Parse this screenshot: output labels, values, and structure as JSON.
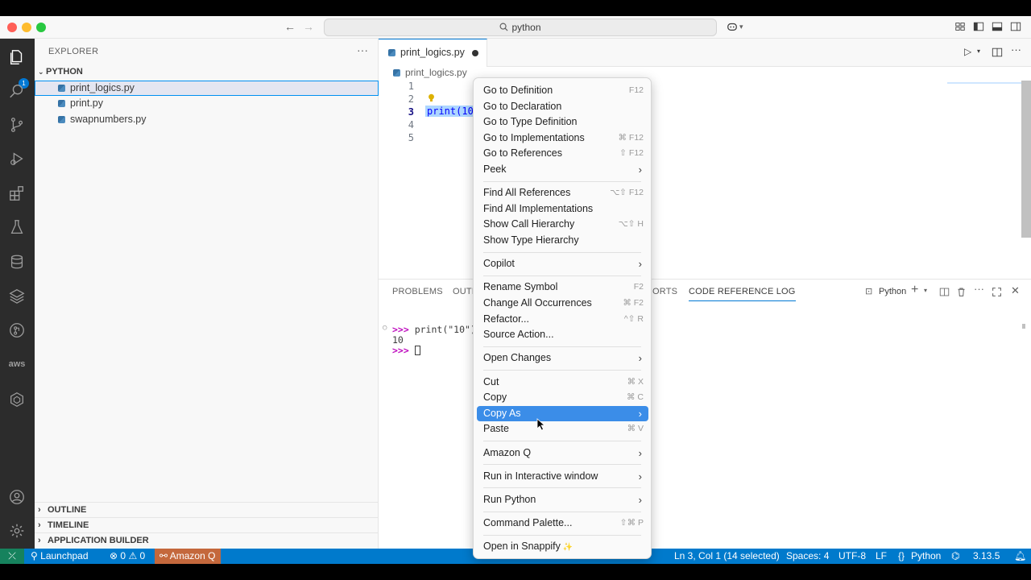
{
  "titlebar": {
    "search_text": "python",
    "search_icon": "search-icon",
    "copilot_icon": "copilot-icon"
  },
  "activity_bar": {
    "explorer_badge": "1",
    "items": [
      "files-icon",
      "search-icon",
      "source-control-icon",
      "run-debug-icon",
      "extensions-icon",
      "testing-icon",
      "database-icon",
      "layers-icon",
      "gitlens-icon",
      "aws-icon",
      "hexagon-icon"
    ],
    "aws_label": "aws",
    "bottom_items": [
      "account-icon",
      "settings-gear-icon"
    ]
  },
  "sidebar": {
    "header": "EXPLORER",
    "more": "···",
    "folder": "PYTHON",
    "files": [
      "print_logics.py",
      "print.py",
      "swapnumbers.py"
    ],
    "selected_file": "print_logics.py",
    "outline": "OUTLINE",
    "timeline": "TIMELINE",
    "app_builder": "APPLICATION BUILDER"
  },
  "editor": {
    "tab_label": "print_logics.py",
    "breadcrumb": "print_logics.py",
    "line_numbers": [
      "1",
      "2",
      "3",
      "4",
      "5"
    ],
    "current_line": "3",
    "line3_code": "print(10"
  },
  "panel": {
    "tabs": {
      "problems": "PROBLEMS",
      "output": "OUTP",
      "ports": "ORTS",
      "code_reference_log": "CODE REFERENCE LOG"
    },
    "terminal_name": "Python",
    "terminal": {
      "prompt": ">>>",
      "line1_cmd": " print(\"10\")",
      "line2": "10",
      "prompt2": ">>>"
    }
  },
  "context_menu": {
    "groups": [
      [
        {
          "label": "Go to Definition",
          "kb": "F12"
        },
        {
          "label": "Go to Declaration",
          "kb": ""
        },
        {
          "label": "Go to Type Definition",
          "kb": ""
        },
        {
          "label": "Go to Implementations",
          "kb": "⌘ F12"
        },
        {
          "label": "Go to References",
          "kb": "⇧ F12"
        },
        {
          "label": "Peek",
          "sub": "›"
        }
      ],
      [
        {
          "label": "Find All References",
          "kb": "⌥⇧ F12"
        },
        {
          "label": "Find All Implementations",
          "kb": ""
        },
        {
          "label": "Show Call Hierarchy",
          "kb": "⌥⇧ H"
        },
        {
          "label": "Show Type Hierarchy",
          "kb": ""
        }
      ],
      [
        {
          "label": "Copilot",
          "sub": "›"
        }
      ],
      [
        {
          "label": "Rename Symbol",
          "kb": "F2"
        },
        {
          "label": "Change All Occurrences",
          "kb": "⌘ F2"
        },
        {
          "label": "Refactor...",
          "kb": "^⇧ R"
        },
        {
          "label": "Source Action...",
          "kb": ""
        }
      ],
      [
        {
          "label": "Open Changes",
          "sub": "›"
        }
      ],
      [
        {
          "label": "Cut",
          "kb": "⌘ X"
        },
        {
          "label": "Copy",
          "kb": "⌘ C"
        },
        {
          "label": "Copy As",
          "sub": "›",
          "highlighted": true
        },
        {
          "label": "Paste",
          "kb": "⌘ V"
        }
      ],
      [
        {
          "label": "Amazon Q",
          "sub": "›"
        }
      ],
      [
        {
          "label": "Run in Interactive window",
          "sub": "›"
        }
      ],
      [
        {
          "label": "Run Python",
          "sub": "›"
        }
      ],
      [
        {
          "label": "Command Palette...",
          "kb": "⇧⌘ P"
        }
      ],
      [
        {
          "label": "Open in Snappify",
          "kb": ""
        }
      ]
    ],
    "sparkle": "✨"
  },
  "status_bar": {
    "remote_icon": "remote-icon",
    "launchpad": "Launchpad",
    "errors": "0",
    "warnings": "0",
    "amazon_q": "Amazon Q",
    "position": "Ln 3, Col 1 (14 selected)",
    "spaces": "Spaces: 4",
    "encoding": "UTF-8",
    "eol": "LF",
    "language": "Python",
    "braces": "{}",
    "version": "3.13.5"
  },
  "colors": {
    "accent": "#0078d4",
    "status_bar": "#007acc",
    "menu_highlight": "#3b8de8",
    "amazon_q": "#c4683c",
    "remote": "#16825d"
  }
}
